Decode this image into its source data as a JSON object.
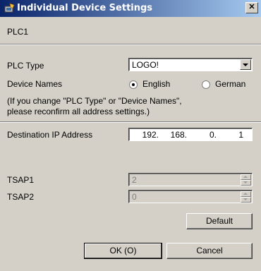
{
  "window": {
    "title": "Individual Device Settings",
    "close": "✕"
  },
  "header": {
    "device": "PLC1"
  },
  "plc_type": {
    "label": "PLC Type",
    "value": "LOGO!"
  },
  "device_names": {
    "label": "Device Names",
    "options": [
      "English",
      "German"
    ],
    "selected": "English"
  },
  "note": {
    "line1": "(If you change \"PLC Type\" or \"Device Names\",",
    "line2": "please reconfirm all address settings.)"
  },
  "ip": {
    "label": "Destination IP Address",
    "octets": [
      "192.",
      "168.",
      "0.",
      "1"
    ]
  },
  "tsap1": {
    "label": "TSAP1",
    "value": "2"
  },
  "tsap2": {
    "label": "TSAP2",
    "value": "0"
  },
  "buttons": {
    "default": "Default",
    "ok": "OK (O)",
    "cancel": "Cancel"
  },
  "icons": {
    "title": "device-settings-icon",
    "close": "close-icon"
  }
}
